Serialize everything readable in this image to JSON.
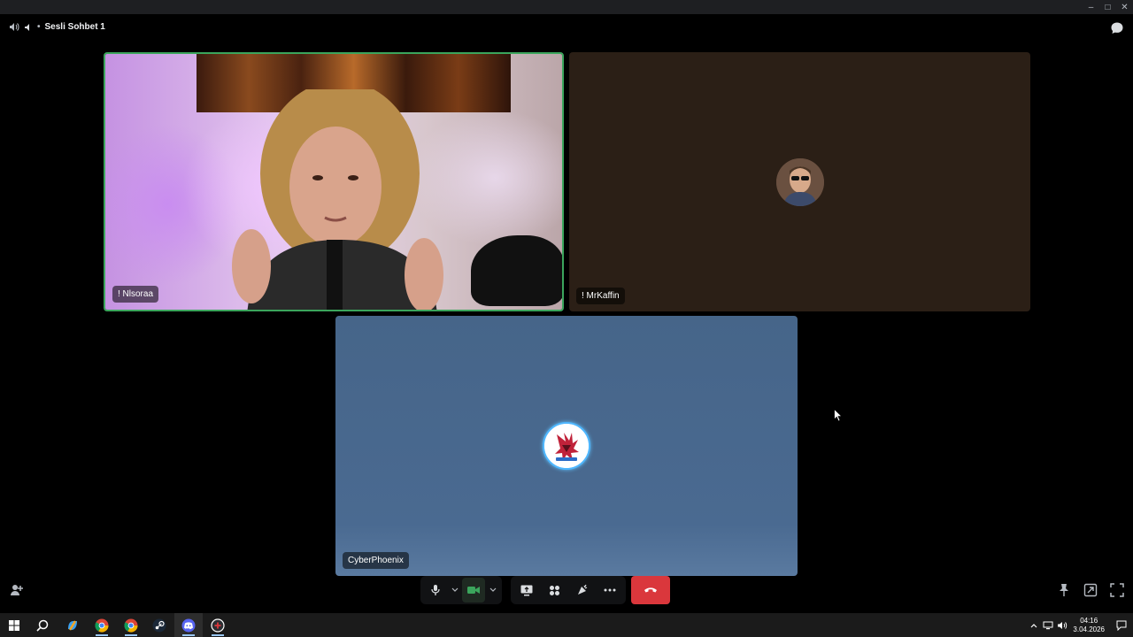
{
  "window": {
    "minimize": "–",
    "maximize": "□",
    "close": "✕"
  },
  "header": {
    "channel_name": "Sesli Sohbet 1",
    "speaker_icon": "speaker-icon",
    "chat_icon": "chat-bubble-icon"
  },
  "participants": [
    {
      "name": "! Nlsoraa",
      "video_on": true,
      "speaking": true
    },
    {
      "name": "! MrKaffin",
      "video_on": false,
      "background_color": "#2b1f16"
    },
    {
      "name": "CyberPhoenix",
      "video_on": false,
      "background_color": "#466589"
    }
  ],
  "controls": {
    "mic": "microphone-icon",
    "mic_options": "chevron-down-icon",
    "camera": "camera-icon",
    "camera_options": "chevron-down-icon",
    "screen_share": "screen-share-icon",
    "activities": "activities-icon",
    "soundboard": "soundboard-icon",
    "more": "more-icon",
    "leave": "hangup-icon",
    "add_user": "add-user-icon",
    "pin": "pin-icon",
    "popout": "popout-icon",
    "fullscreen": "fullscreen-icon",
    "camera_color": "#3ba55c",
    "leave_color": "#da373c"
  },
  "taskbar": {
    "apps": [
      "windows-start-icon",
      "search-icon",
      "copilot-icon",
      "chrome-icon",
      "chrome-profile-icon",
      "steam-icon",
      "discord-icon",
      "discord-alt-icon"
    ],
    "clock_time": "04:16",
    "clock_date": "3.04.2026"
  }
}
